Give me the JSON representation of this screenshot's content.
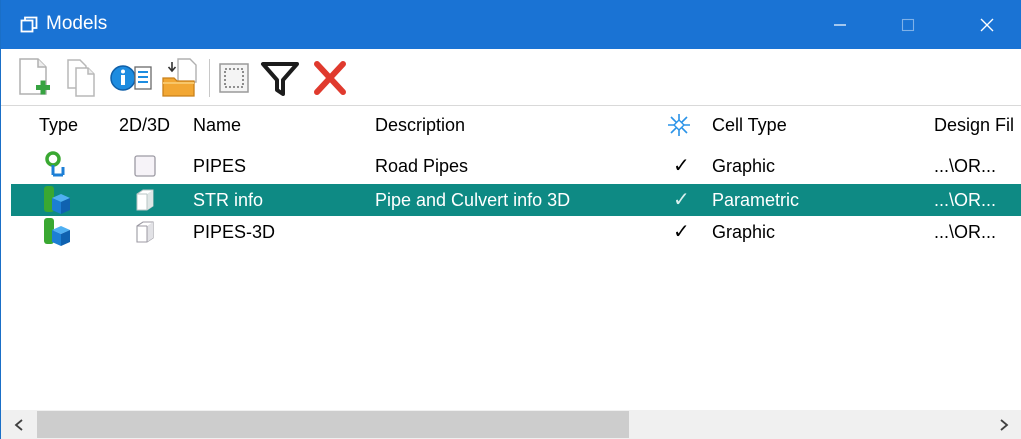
{
  "window": {
    "title": "Models",
    "accent": "#1a73d4",
    "selection_color": "#0e8a84"
  },
  "toolbar": {
    "buttons": [
      {
        "icon": "new-model-icon"
      },
      {
        "icon": "copy-model-icon"
      },
      {
        "icon": "model-properties-icon"
      },
      {
        "icon": "import-model-icon"
      },
      {
        "icon": "select-all-icon"
      },
      {
        "icon": "filter-icon"
      },
      {
        "icon": "delete-icon"
      }
    ]
  },
  "columns": {
    "type": "Type",
    "dim": "2D/3D",
    "name": "Name",
    "description": "Description",
    "placement_icon": "cell-placement-icon",
    "cell_type": "Cell Type",
    "design_file": "Design Fil"
  },
  "rows": [
    {
      "type_icon": "design-model-icon",
      "dim_icon": "2d-model-icon",
      "name": "PIPES",
      "description": "Road Pipes",
      "check": "✓",
      "cell_type": "Graphic",
      "design_file": "...\\OR...",
      "selected": false
    },
    {
      "type_icon": "3d-design-model-icon",
      "dim_icon": "3d-model-icon",
      "name": "STR info",
      "description": "Pipe and Culvert info 3D",
      "check": "✓",
      "cell_type": "Parametric",
      "design_file": "...\\OR...",
      "selected": true
    },
    {
      "type_icon": "3d-design-model-icon",
      "dim_icon": "3d-model-icon",
      "name": "PIPES-3D",
      "description": "",
      "check": "✓",
      "cell_type": "Graphic",
      "design_file": "...\\OR...",
      "selected": false
    }
  ]
}
